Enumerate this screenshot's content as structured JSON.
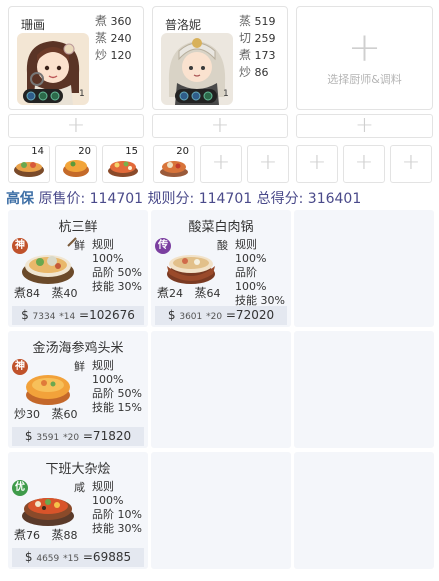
{
  "chefs": [
    {
      "name": "珊画",
      "level": "1",
      "stats": [
        {
          "k": "煮",
          "v": "360"
        },
        {
          "k": "蒸",
          "v": "240"
        },
        {
          "k": "炒",
          "v": "120"
        }
      ]
    },
    {
      "name": "普洛妮",
      "level": "1",
      "stats": [
        {
          "k": "蒸",
          "v": "519"
        },
        {
          "k": "切",
          "v": "259"
        },
        {
          "k": "煮",
          "v": "173"
        },
        {
          "k": "炒",
          "v": "86"
        }
      ]
    }
  ],
  "empty_chef": {
    "plus": "+",
    "label": "选择厨师&调料"
  },
  "equip_plus": "+",
  "ingredients": [
    {
      "count": "14",
      "icon": "noodle-soup-icon"
    },
    {
      "count": "20",
      "icon": "stew-bowl-icon"
    },
    {
      "count": "15",
      "icon": "hotpot-icon"
    },
    {
      "count": "20",
      "icon": "chicken-dish-icon"
    }
  ],
  "ingredient_plus": "+",
  "score": {
    "prefix": "高保",
    "sale_label": "原售价:",
    "sale_value": "114701",
    "rule_label": "规则分:",
    "rule_value": "114701",
    "total_label": "总得分:",
    "total_value": "316401"
  },
  "dishes": [
    {
      "name": "杭三鲜",
      "rarity": "神",
      "rarity_color": "#c0522b",
      "tag": "鲜",
      "rules": [
        "规则 100%",
        "品阶 50%",
        "技能 30%"
      ],
      "skills": [
        {
          "k": "煮",
          "v": "84"
        },
        {
          "k": "蒸",
          "v": "40"
        }
      ],
      "price": "7334",
      "qty": "*14",
      "total": "=102676"
    },
    {
      "name": "酸菜白肉锅",
      "rarity": "传",
      "rarity_color": "#7b3fa0",
      "tag": "酸",
      "rules": [
        "规则 100%",
        "品阶 100%",
        "技能 30%"
      ],
      "skills": [
        {
          "k": "煮",
          "v": "24"
        },
        {
          "k": "蒸",
          "v": "64"
        }
      ],
      "price": "3601",
      "qty": "*20",
      "total": "=72020"
    },
    {
      "name": "金汤海参鸡头米",
      "rarity": "神",
      "rarity_color": "#c0522b",
      "tag": "鲜",
      "rules": [
        "规则 100%",
        "品阶 50%",
        "技能 15%"
      ],
      "skills": [
        {
          "k": "炒",
          "v": "30"
        },
        {
          "k": "蒸",
          "v": "60"
        }
      ],
      "price": "3591",
      "qty": "*20",
      "total": "=71820"
    },
    {
      "name": "下班大杂烩",
      "rarity": "优",
      "rarity_color": "#3f9b4a",
      "tag": "咸",
      "rules": [
        "规则 100%",
        "品阶 10%",
        "技能 30%"
      ],
      "skills": [
        {
          "k": "煮",
          "v": "76"
        },
        {
          "k": "蒸",
          "v": "88"
        }
      ],
      "price": "4659",
      "qty": "*15",
      "total": "=69885"
    }
  ],
  "currency": "$"
}
